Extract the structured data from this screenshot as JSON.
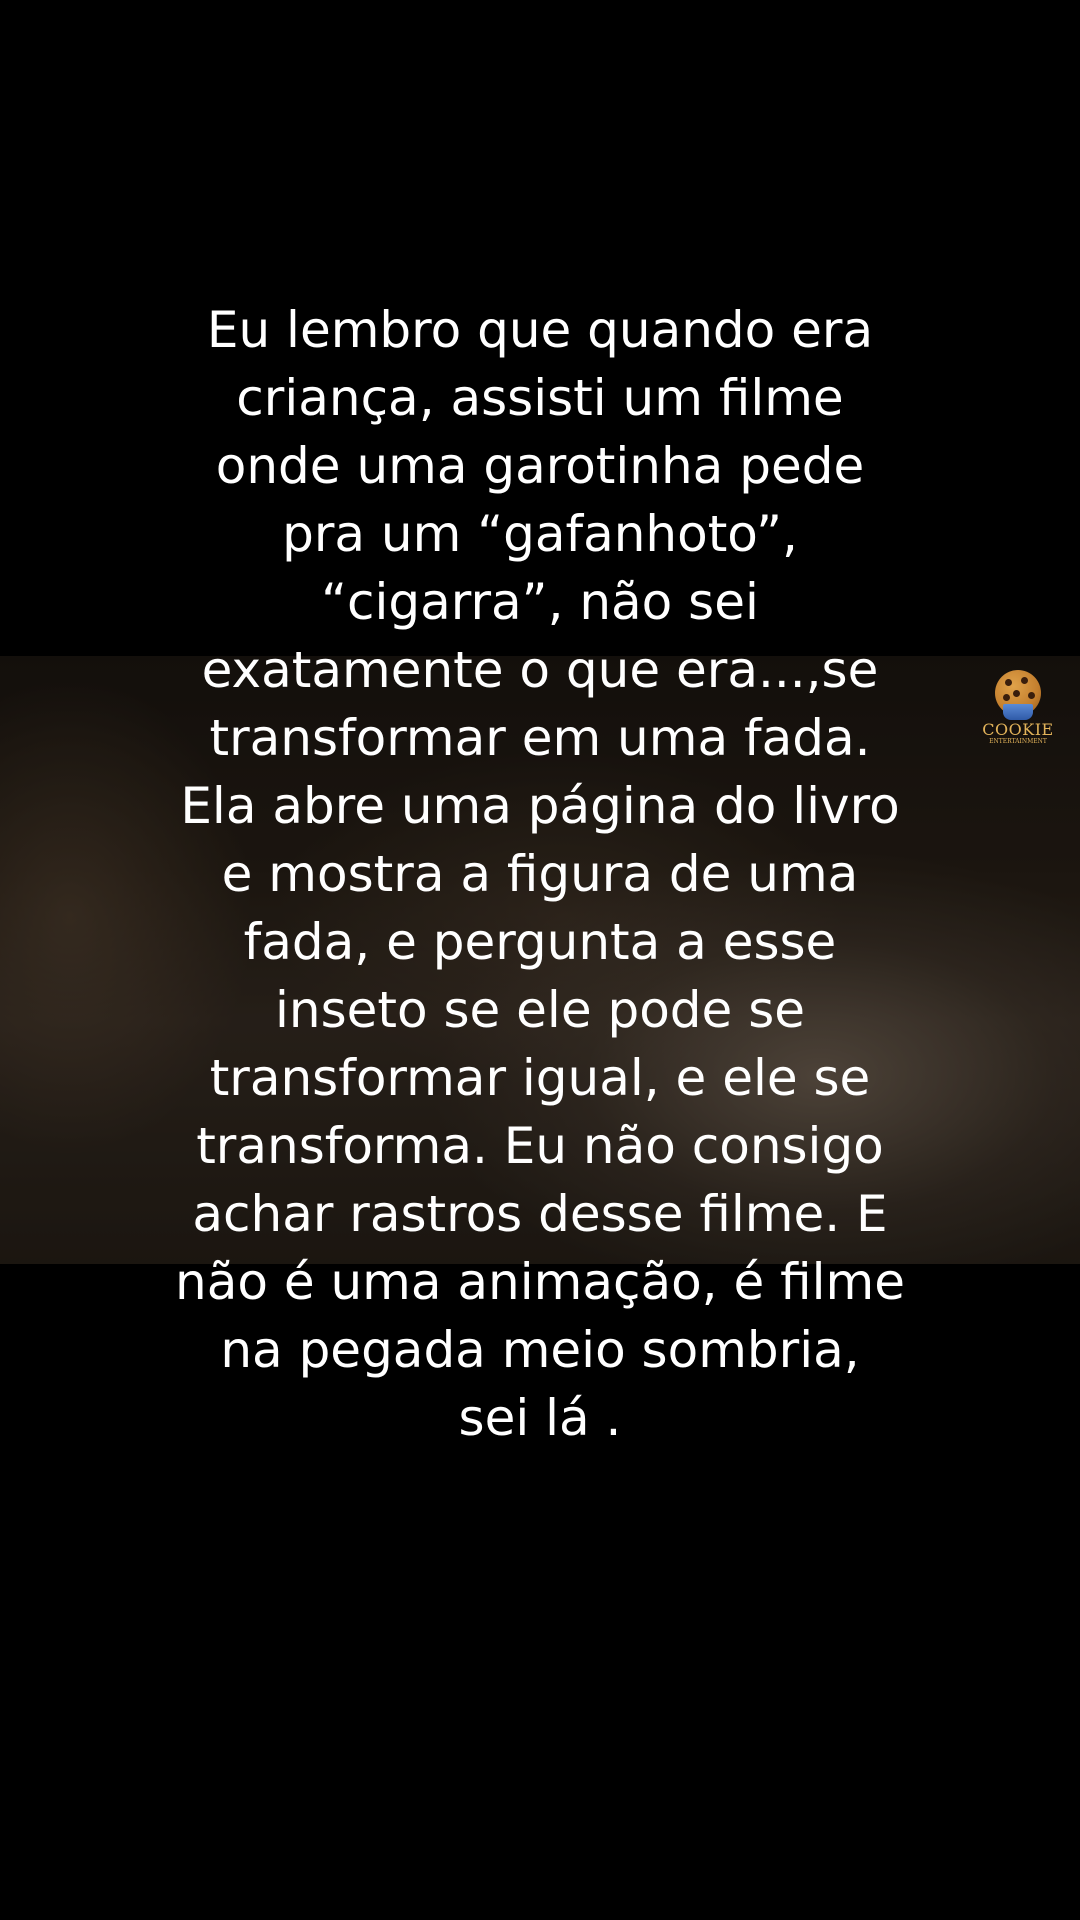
{
  "background_colors": {
    "page": "#000000",
    "text": "#ffffff",
    "logo": "#e2b35a"
  },
  "story": {
    "lines": [
      "Eu lembro que quando era",
      "criança, assisti um filme",
      "onde uma garotinha pede",
      "pra um “gafanhoto”,",
      "“cigarra”, não sei",
      "exatamente o que era...,se",
      "transformar em uma fada.",
      "Ela abre uma página do livro",
      "e mostra a figura de uma",
      "fada, e pergunta a esse",
      "inseto se ele pode se",
      "transformar igual, e ele se",
      "transforma. Eu não consigo",
      "achar rastros desse filme. E",
      "não é uma animação, é filme",
      "na pegada meio sombria,",
      "sei lá ."
    ]
  },
  "logo": {
    "icon": "cookie-icon",
    "word": "COOKIE",
    "subtitle": "ENTERTAINMENT"
  }
}
